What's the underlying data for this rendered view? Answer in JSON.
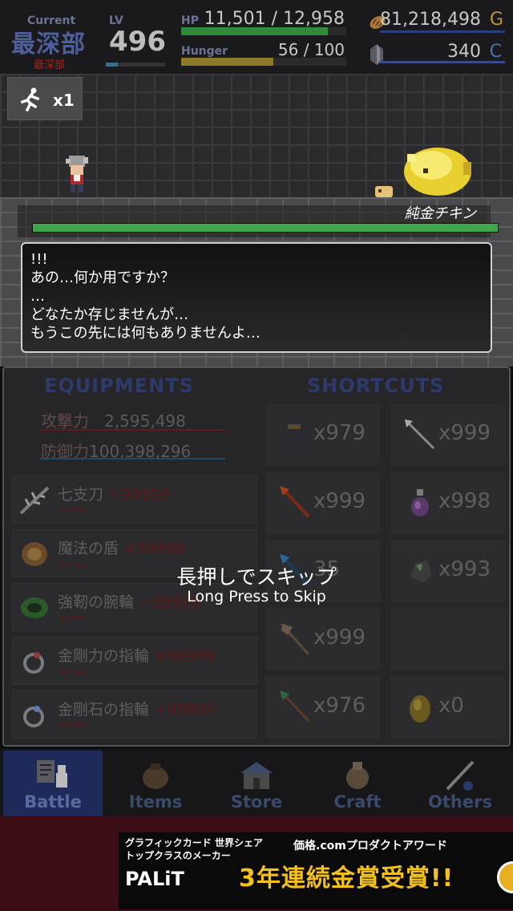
{
  "hud": {
    "floor_label": "Current",
    "floor_name": "最深部",
    "floor_sub": "最深部",
    "level_label": "LV",
    "level": "496",
    "hp_label": "HP",
    "hp_text": "11,501 / 12,958",
    "hp_fraction": 0.888,
    "hunger_label": "Hunger",
    "hunger_text": "56 / 100",
    "hunger_fraction": 0.56,
    "gold_value": "81,218,498",
    "gold_unit": "G",
    "gold_icon": "bread-icon",
    "crystal_value": "340",
    "crystal_unit": "C",
    "crystal_icon": "crystal-icon"
  },
  "scene": {
    "speed_icon": "running-man-icon",
    "speed_value": "x1",
    "enemy_name": "純金チキン",
    "enemy_hp_fraction": 1.0,
    "dialog_lines": [
      "!!!",
      "あの…何か用ですか？",
      "…",
      "どなたか存じませんが…",
      "もうこの先には何もありませんよ…"
    ]
  },
  "equipments": {
    "title": "EQUIPMENTS",
    "attack_label": "攻撃力",
    "attack_value": "2,595,498",
    "defense_label": "防御力",
    "defense_value": "100,398,296",
    "items": [
      {
        "name": "七支刀",
        "plus": "+99999",
        "max": "★max",
        "icon": "seven-branched-sword-icon"
      },
      {
        "name": "魔法の盾",
        "plus": "+99999",
        "max": "★max",
        "icon": "magic-shield-icon"
      },
      {
        "name": "強靭の腕輪",
        "plus": "+99999",
        "max": "★max",
        "icon": "bracelet-icon"
      },
      {
        "name": "金剛力の指輪",
        "plus": "+99999",
        "max": "★max",
        "icon": "ring-icon"
      },
      {
        "name": "金剛石の指輪",
        "plus": "+99999",
        "max": "★max",
        "icon": "diamond-ring-icon"
      }
    ]
  },
  "shortcuts": {
    "title": "SHORTCUTS",
    "slots": [
      {
        "count": "x979",
        "icon": "spellbook-icon"
      },
      {
        "count": "x999",
        "icon": "arrow-icon"
      },
      {
        "count": "x999",
        "icon": "fire-spear-icon"
      },
      {
        "count": "x998",
        "icon": "potion-icon"
      },
      {
        "count": "35",
        "icon": "ice-spear-icon"
      },
      {
        "count": "x993",
        "icon": "ore-icon"
      },
      {
        "count": "x999",
        "icon": "halberd-icon"
      },
      {
        "count": "",
        "icon": ""
      },
      {
        "count": "x976",
        "icon": "emerald-spear-icon"
      },
      {
        "count": "x0",
        "icon": "egg-icon"
      }
    ]
  },
  "skip": {
    "main": "長押しでスキップ",
    "sub": "Long Press to Skip"
  },
  "tabs": [
    {
      "label": "Battle",
      "icon": "battle-icon"
    },
    {
      "label": "Items",
      "icon": "bag-icon"
    },
    {
      "label": "Store",
      "icon": "store-icon"
    },
    {
      "label": "Craft",
      "icon": "anvil-icon"
    },
    {
      "label": "Others",
      "icon": "quill-icon"
    }
  ],
  "ad": {
    "left_line1": "グラフィックカード 世界シェア",
    "left_line2": "トップクラスのメーカー",
    "brand": "PALiT",
    "right_line1": "価格.comプロダクトアワード",
    "right_line2": "3年連続金賞受賞!!"
  }
}
